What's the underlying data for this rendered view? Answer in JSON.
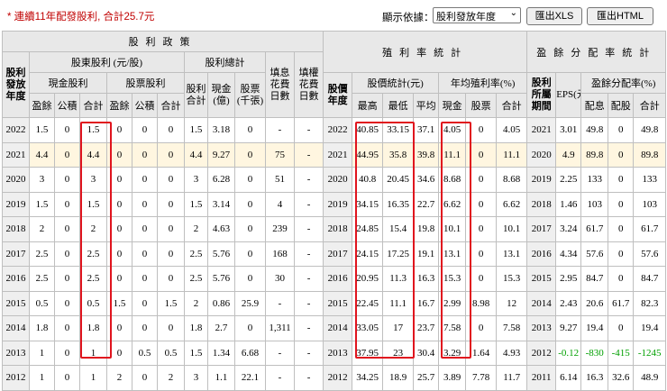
{
  "summary": "* 連續11年配發股利, 合計25.7元",
  "sort": {
    "label": "顯示依據：",
    "selected": "股利發放年度"
  },
  "buttons": {
    "xls": "匯出XLS",
    "html": "匯出HTML"
  },
  "headers": {
    "dividend_policy": "股利政策",
    "year_col": "股利發放年度",
    "shareholder_dividend": "股東股利 (元/股)",
    "dividend_total_group": "股利總計",
    "fill_days": "填息花費日數",
    "fill_rights_days": "填權花費日數",
    "cash_dividend": "現金股利",
    "stock_dividend": "股票股利",
    "surplus": "盈餘",
    "reserve": "公積",
    "subtotal": "合計",
    "dividend_total": "股利合計",
    "cash_100m": "現金(億)",
    "stock_k": "股票(千張)",
    "yield_stats": "殖利率統計",
    "stock_year": "股價年度",
    "price_stats": "股價統計(元)",
    "high": "最高",
    "low": "最低",
    "avg": "平均",
    "avg_yield": "年均殖利率(%)",
    "cash": "現金",
    "stock": "股票",
    "payout_stats": "盈餘分配率統計",
    "earn_period": "股利所屬期間",
    "eps": "EPS(元)",
    "payout_ratio": "盈餘分配率(%)",
    "p_cash": "配息",
    "p_stock": "配股"
  },
  "rows": [
    [
      "2022",
      "1.5",
      "0",
      "1.5",
      "0",
      "0",
      "0",
      "1.5",
      "3.18",
      "0",
      "-",
      "-",
      "2022",
      "40.85",
      "33.15",
      "37.1",
      "4.05",
      "0",
      "4.05",
      "2021",
      "3.01",
      "49.8",
      "0",
      "49.8"
    ],
    [
      "2021",
      "4.4",
      "0",
      "4.4",
      "0",
      "0",
      "0",
      "4.4",
      "9.27",
      "0",
      "75",
      "-",
      "2021",
      "44.95",
      "35.8",
      "39.8",
      "11.1",
      "0",
      "11.1",
      "2020",
      "4.9",
      "89.8",
      "0",
      "89.8"
    ],
    [
      "2020",
      "3",
      "0",
      "3",
      "0",
      "0",
      "0",
      "3",
      "6.28",
      "0",
      "51",
      "-",
      "2020",
      "40.8",
      "20.45",
      "34.6",
      "8.68",
      "0",
      "8.68",
      "2019",
      "2.25",
      "133",
      "0",
      "133"
    ],
    [
      "2019",
      "1.5",
      "0",
      "1.5",
      "0",
      "0",
      "0",
      "1.5",
      "3.14",
      "0",
      "4",
      "-",
      "2019",
      "34.15",
      "16.35",
      "22.7",
      "6.62",
      "0",
      "6.62",
      "2018",
      "1.46",
      "103",
      "0",
      "103"
    ],
    [
      "2018",
      "2",
      "0",
      "2",
      "0",
      "0",
      "0",
      "2",
      "4.63",
      "0",
      "239",
      "-",
      "2018",
      "24.85",
      "15.4",
      "19.8",
      "10.1",
      "0",
      "10.1",
      "2017",
      "3.24",
      "61.7",
      "0",
      "61.7"
    ],
    [
      "2017",
      "2.5",
      "0",
      "2.5",
      "0",
      "0",
      "0",
      "2.5",
      "5.76",
      "0",
      "168",
      "-",
      "2017",
      "24.15",
      "17.25",
      "19.1",
      "13.1",
      "0",
      "13.1",
      "2016",
      "4.34",
      "57.6",
      "0",
      "57.6"
    ],
    [
      "2016",
      "2.5",
      "0",
      "2.5",
      "0",
      "0",
      "0",
      "2.5",
      "5.76",
      "0",
      "30",
      "-",
      "2016",
      "20.95",
      "11.3",
      "16.3",
      "15.3",
      "0",
      "15.3",
      "2015",
      "2.95",
      "84.7",
      "0",
      "84.7"
    ],
    [
      "2015",
      "0.5",
      "0",
      "0.5",
      "1.5",
      "0",
      "1.5",
      "2",
      "0.86",
      "25.9",
      "-",
      "-",
      "2015",
      "22.45",
      "11.1",
      "16.7",
      "2.99",
      "8.98",
      "12",
      "2014",
      "2.43",
      "20.6",
      "61.7",
      "82.3"
    ],
    [
      "2014",
      "1.8",
      "0",
      "1.8",
      "0",
      "0",
      "0",
      "1.8",
      "2.7",
      "0",
      "1,311",
      "-",
      "2014",
      "33.05",
      "17",
      "23.7",
      "7.58",
      "0",
      "7.58",
      "2013",
      "9.27",
      "19.4",
      "0",
      "19.4"
    ],
    [
      "2013",
      "1",
      "0",
      "1",
      "0",
      "0.5",
      "0.5",
      "1.5",
      "1.34",
      "6.68",
      "-",
      "-",
      "2013",
      "37.95",
      "23",
      "30.4",
      "3.29",
      "1.64",
      "4.93",
      "2012",
      "-0.12",
      "-830",
      "-415",
      "-1245"
    ],
    [
      "2012",
      "1",
      "0",
      "1",
      "2",
      "0",
      "2",
      "3",
      "1.1",
      "22.1",
      "-",
      "-",
      "2012",
      "34.25",
      "18.9",
      "25.7",
      "3.89",
      "7.78",
      "11.7",
      "2011",
      "6.14",
      "16.3",
      "32.6",
      "48.9"
    ]
  ],
  "highlight_row": "2021",
  "colors": {
    "highlight": "#fff6e0",
    "red_box": "#e0141e",
    "summary": "#c00000",
    "negative": "#00a000"
  }
}
